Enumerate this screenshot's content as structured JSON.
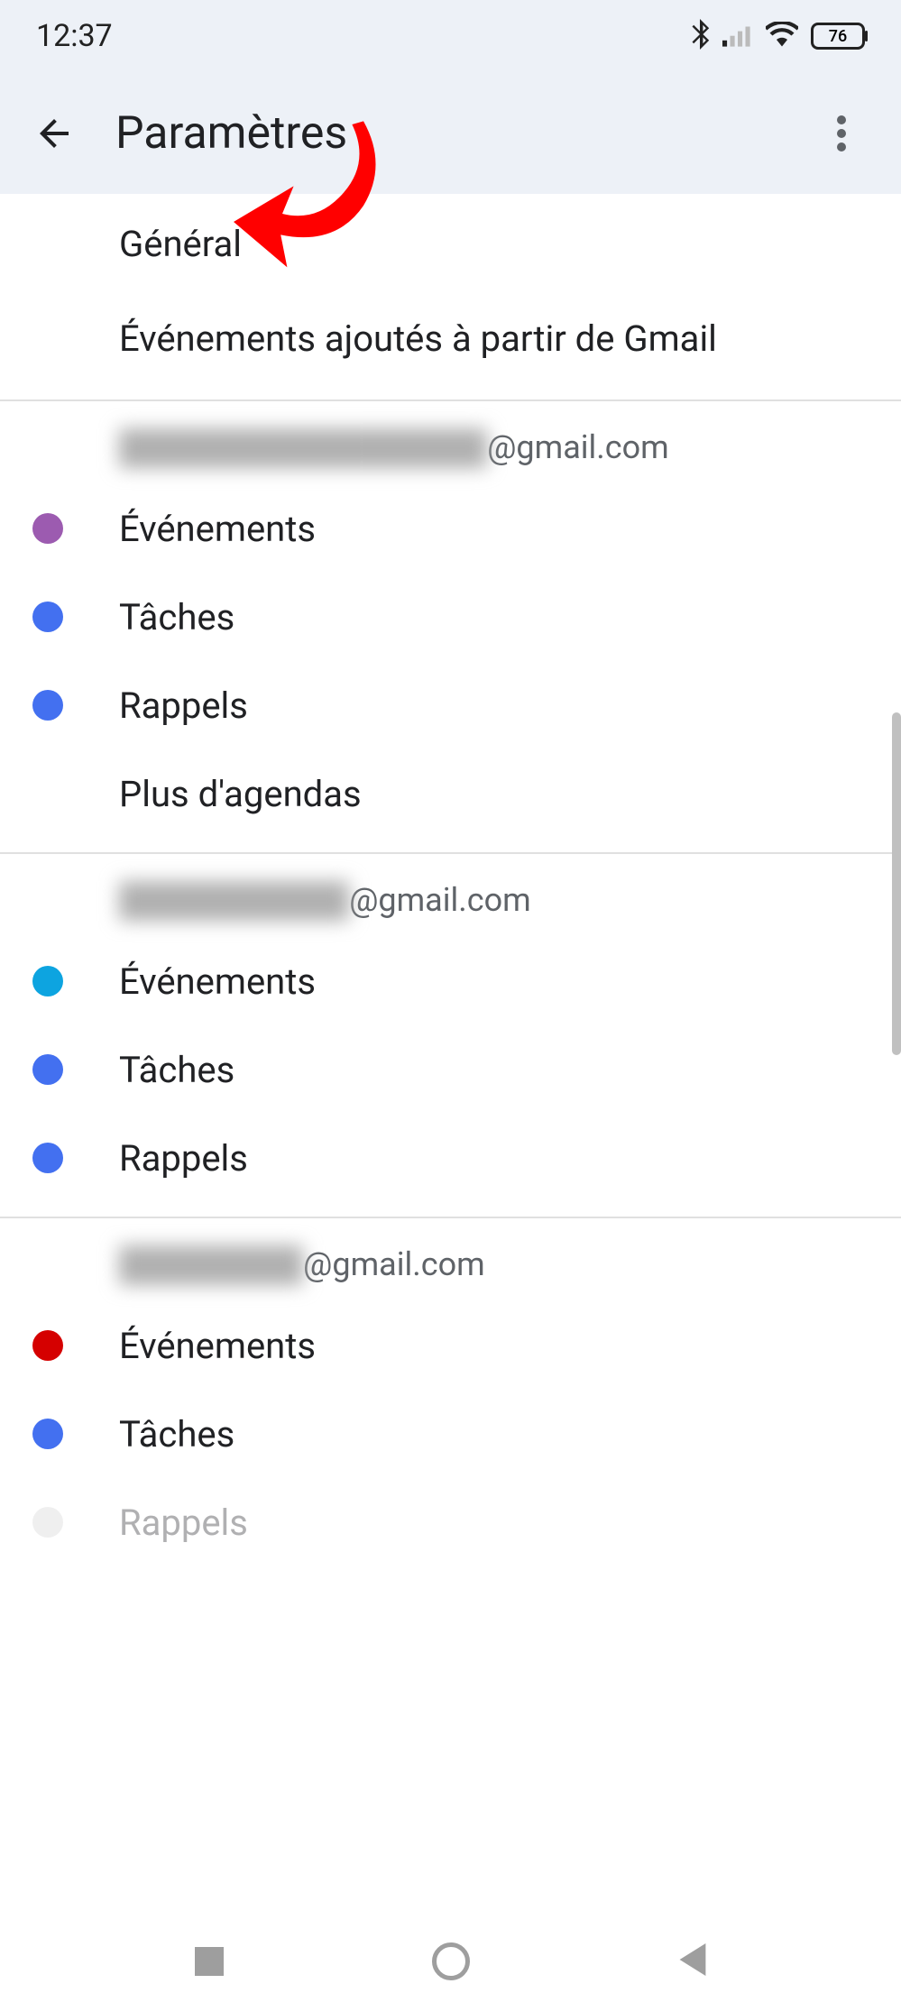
{
  "status_bar": {
    "time": "12:37",
    "battery": "76"
  },
  "header": {
    "title": "Paramètres"
  },
  "top_section": {
    "general": "Général",
    "gmail_events": "Événements ajoutés à partir de Gmail"
  },
  "accounts": [
    {
      "email_suffix": "@gmail.com",
      "items": [
        {
          "label": "Événements",
          "color": "#9c5bb0"
        },
        {
          "label": "Tâches",
          "color": "#4370f0"
        },
        {
          "label": "Rappels",
          "color": "#4370f0"
        },
        {
          "label": "Plus d'agendas",
          "color": null
        }
      ]
    },
    {
      "email_suffix": "@gmail.com",
      "items": [
        {
          "label": "Événements",
          "color": "#0da4e0"
        },
        {
          "label": "Tâches",
          "color": "#4370f0"
        },
        {
          "label": "Rappels",
          "color": "#4370f0"
        }
      ]
    },
    {
      "email_suffix": "@gmail.com",
      "items": [
        {
          "label": "Événements",
          "color": "#d50000"
        },
        {
          "label": "Tâches",
          "color": "#4370f0"
        },
        {
          "label": "Rappels",
          "color": "#e8e8e8"
        }
      ]
    }
  ]
}
